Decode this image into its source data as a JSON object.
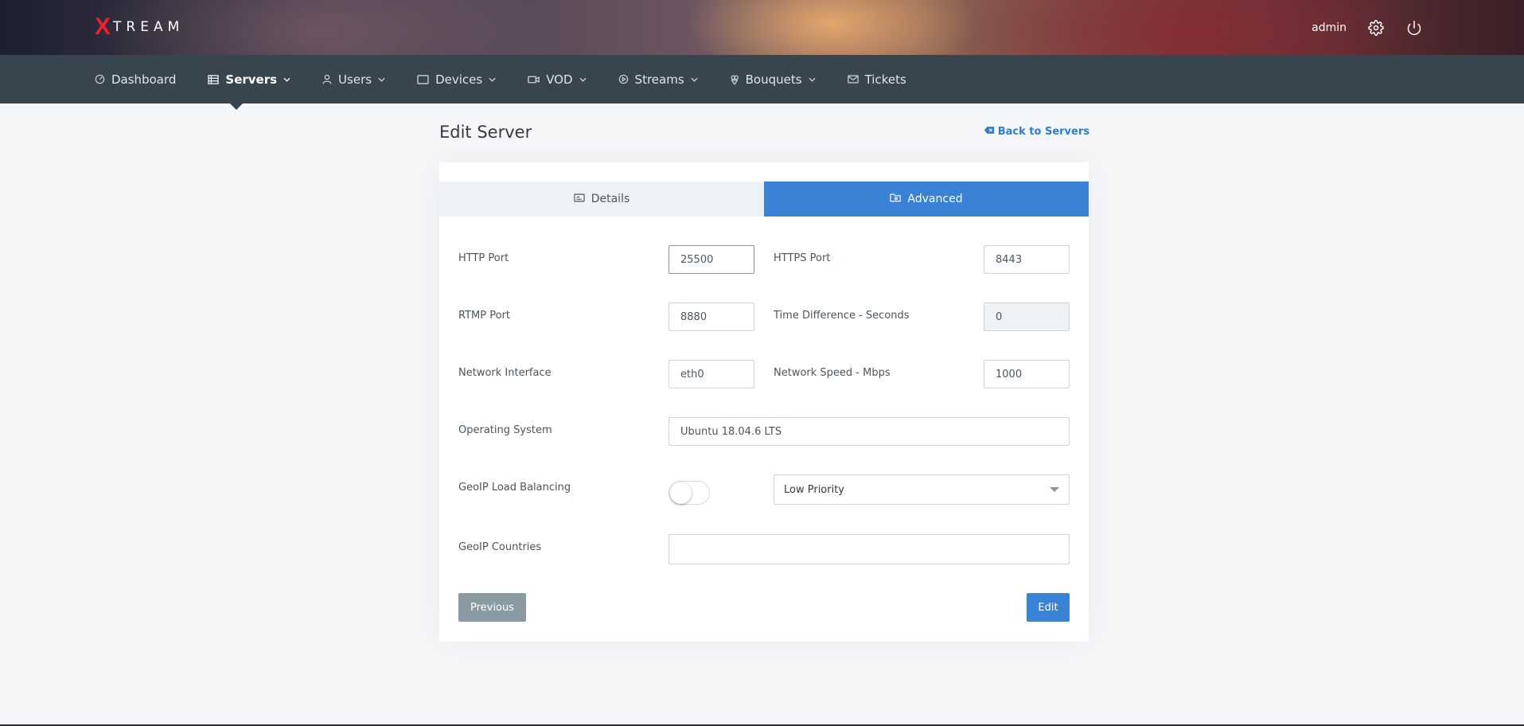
{
  "brand": {
    "logo_x": "X",
    "logo_rest": "TREAM"
  },
  "header": {
    "username": "admin",
    "settings_icon": "gear-icon",
    "power_icon": "power-icon"
  },
  "nav": {
    "items": [
      {
        "label": "Dashboard",
        "icon": "dashboard-icon",
        "has_dropdown": false
      },
      {
        "label": "Servers",
        "icon": "servers-icon",
        "has_dropdown": true,
        "active": true
      },
      {
        "label": "Users",
        "icon": "user-icon",
        "has_dropdown": true
      },
      {
        "label": "Devices",
        "icon": "devices-icon",
        "has_dropdown": true
      },
      {
        "label": "VOD",
        "icon": "vod-icon",
        "has_dropdown": true
      },
      {
        "label": "Streams",
        "icon": "play-icon",
        "has_dropdown": true
      },
      {
        "label": "Bouquets",
        "icon": "bouquet-icon",
        "has_dropdown": true
      },
      {
        "label": "Tickets",
        "icon": "mail-icon",
        "has_dropdown": false
      }
    ]
  },
  "page": {
    "title": "Edit Server",
    "back_link": "Back to Servers"
  },
  "tabs": {
    "details": "Details",
    "advanced": "Advanced"
  },
  "form": {
    "http_port": {
      "label": "HTTP Port",
      "value": "25500"
    },
    "https_port": {
      "label": "HTTPS Port",
      "value": "8443"
    },
    "rtmp_port": {
      "label": "RTMP Port",
      "value": "8880"
    },
    "time_difference": {
      "label": "Time Difference - Seconds",
      "value": "0"
    },
    "network_interface": {
      "label": "Network Interface",
      "value": "eth0"
    },
    "network_speed": {
      "label": "Network Speed - Mbps",
      "value": "1000"
    },
    "operating_system": {
      "label": "Operating System",
      "value": "Ubuntu 18.04.6 LTS"
    },
    "geoip_load_balancing": {
      "label": "GeoIP Load Balancing",
      "enabled": false,
      "priority": "Low Priority"
    },
    "geoip_countries": {
      "label": "GeoIP Countries",
      "value": ""
    }
  },
  "buttons": {
    "previous": "Previous",
    "edit": "Edit"
  },
  "colors": {
    "accent": "#3a82d6",
    "navbar": "#37454e",
    "brand_red": "#e8232f"
  }
}
